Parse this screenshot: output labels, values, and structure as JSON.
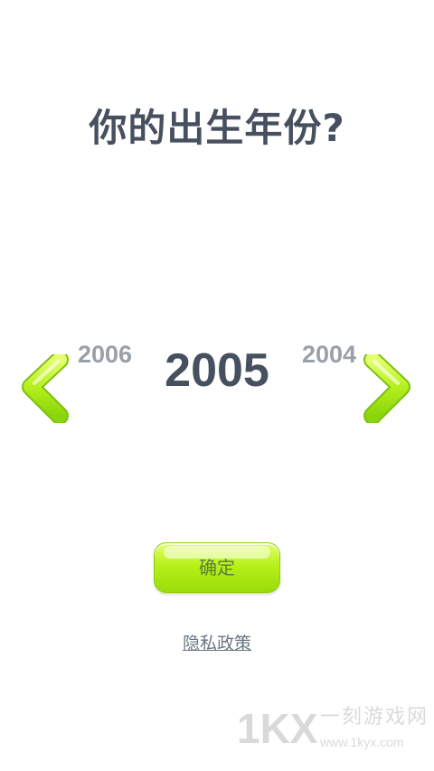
{
  "title": "你的出生年份?",
  "year_picker": {
    "previous": "2006",
    "current": "2005",
    "next": "2004"
  },
  "confirm_label": "确定",
  "privacy_label": "隐私政策",
  "watermark": {
    "logo": "1KX",
    "text": "一刻游戏网",
    "url": "www.1kyx.com"
  },
  "icons": {
    "left": "chevron-left-icon",
    "right": "chevron-right-icon"
  },
  "colors": {
    "title": "#46505e",
    "side_year": "#9aa0a7",
    "button_green": "#b8f01a",
    "arrow_green": "#9ee31a"
  }
}
